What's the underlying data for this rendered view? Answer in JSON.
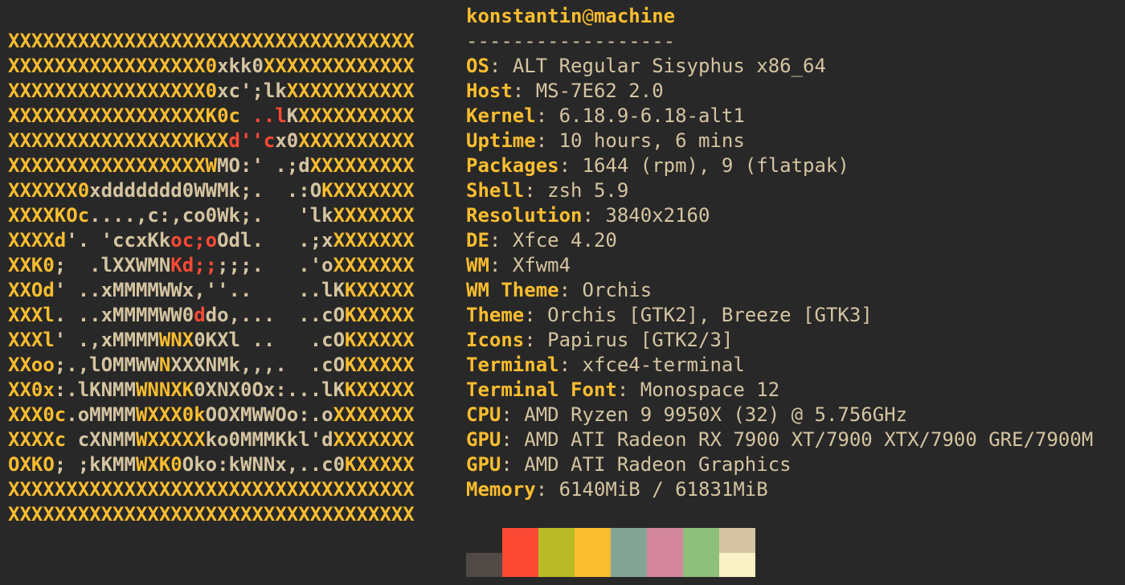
{
  "colors": {
    "background": "#282828",
    "foreground": "#d5c4a1",
    "accent_yellow": "#fabd2f",
    "accent_red": "#fb4934"
  },
  "logo": {
    "lines": [
      [
        {
          "t": "XXXXXXXXXXXXXXXXXXXXXXXXXXXXXXXXXXX",
          "c": "y"
        }
      ],
      [
        {
          "t": "XXXXXXXXXXXXXXXXX0",
          "c": "y"
        },
        {
          "t": "xkk0",
          "c": "w"
        },
        {
          "t": "XXXXXXXXXXXXX",
          "c": "y"
        }
      ],
      [
        {
          "t": "XXXXXXXXXXXXXXXXX0",
          "c": "y"
        },
        {
          "t": "xc';lk",
          "c": "w"
        },
        {
          "t": "XXXXXXXXXXX",
          "c": "y"
        }
      ],
      [
        {
          "t": "XXXXXXXXXXXXXXXXXK0c ",
          "c": "y"
        },
        {
          "t": "..l",
          "c": "r"
        },
        {
          "t": "K",
          "c": "w"
        },
        {
          "t": "XXXXXXXXXX",
          "c": "y"
        }
      ],
      [
        {
          "t": "XXXXXXXXXXXXXXXXKXX",
          "c": "y"
        },
        {
          "t": "d''c",
          "c": "r"
        },
        {
          "t": "x0",
          "c": "w"
        },
        {
          "t": "XXXXXXXXXX",
          "c": "y"
        }
      ],
      [
        {
          "t": "XXXXXXXXXXXXXXXXXW",
          "c": "y"
        },
        {
          "t": "MO:' .;d",
          "c": "w"
        },
        {
          "t": "XXXXXXXXX",
          "c": "y"
        }
      ],
      [
        {
          "t": "XXXXXX0",
          "c": "y"
        },
        {
          "t": "xddddddd0WWMk;.  .:O",
          "c": "w"
        },
        {
          "t": "KXXXXXXX",
          "c": "y"
        }
      ],
      [
        {
          "t": "XXXXKOc",
          "c": "y"
        },
        {
          "t": "....,c:,co0Wk;.   'lk",
          "c": "w"
        },
        {
          "t": "XXXXXXX",
          "c": "y"
        }
      ],
      [
        {
          "t": "XXXXd",
          "c": "y"
        },
        {
          "t": "'. 'ccxKk",
          "c": "w"
        },
        {
          "t": "oc;o",
          "c": "r"
        },
        {
          "t": "Odl.   .;x",
          "c": "w"
        },
        {
          "t": "XXXXXXX",
          "c": "y"
        }
      ],
      [
        {
          "t": "XXK0",
          "c": "y"
        },
        {
          "t": ";  .lXXWMN",
          "c": "w"
        },
        {
          "t": "Kd;;",
          "c": "r"
        },
        {
          "t": ";;;.   .'o",
          "c": "w"
        },
        {
          "t": "XXXXXXX",
          "c": "y"
        }
      ],
      [
        {
          "t": "XXOd",
          "c": "y"
        },
        {
          "t": "' ..xMMMMWWx,''..    ..lK",
          "c": "w"
        },
        {
          "t": "KXXXXX",
          "c": "y"
        }
      ],
      [
        {
          "t": "XXXl",
          "c": "y"
        },
        {
          "t": ". ..xMMMMWW0",
          "c": "w"
        },
        {
          "t": "d",
          "c": "r"
        },
        {
          "t": "do,...  ..cO",
          "c": "w"
        },
        {
          "t": "KXXXXX",
          "c": "y"
        }
      ],
      [
        {
          "t": "XXXl",
          "c": "y"
        },
        {
          "t": "' .,xMMMM",
          "c": "w"
        },
        {
          "t": "WNX",
          "c": "y"
        },
        {
          "t": "0KXl ..   .cO",
          "c": "w"
        },
        {
          "t": "KXXXXX",
          "c": "y"
        }
      ],
      [
        {
          "t": "XXoo",
          "c": "y"
        },
        {
          "t": ";.,lOMMWW",
          "c": "w"
        },
        {
          "t": "N",
          "c": "y"
        },
        {
          "t": "XXXNMk,,,.  .cO",
          "c": "w"
        },
        {
          "t": "KXXXXX",
          "c": "y"
        }
      ],
      [
        {
          "t": "XX0x",
          "c": "y"
        },
        {
          "t": ":.lKNMM",
          "c": "w"
        },
        {
          "t": "WNNXK",
          "c": "y"
        },
        {
          "t": "0XNX0Ox:...lK",
          "c": "w"
        },
        {
          "t": "KXXXXX",
          "c": "y"
        }
      ],
      [
        {
          "t": "XXX0c",
          "c": "y"
        },
        {
          "t": ".oMMMM",
          "c": "w"
        },
        {
          "t": "WXXX0k",
          "c": "y"
        },
        {
          "t": "OOXMWWOo:.o",
          "c": "w"
        },
        {
          "t": "XXXXXXX",
          "c": "y"
        }
      ],
      [
        {
          "t": "XXXXc",
          "c": "y"
        },
        {
          "t": " cXNMM",
          "c": "w"
        },
        {
          "t": "WXXXXX",
          "c": "y"
        },
        {
          "t": "ko0MMMKkl'd",
          "c": "w"
        },
        {
          "t": "XXXXXXX",
          "c": "y"
        }
      ],
      [
        {
          "t": "OXKO",
          "c": "y"
        },
        {
          "t": "; ;kKMM",
          "c": "w"
        },
        {
          "t": "WXK0",
          "c": "y"
        },
        {
          "t": "Oko:kWNNx,..c0",
          "c": "w"
        },
        {
          "t": "KXXXXX",
          "c": "y"
        }
      ],
      [
        {
          "t": "XXXXXXXXXXXXXXXXXXXXXXXXXXXXXXXXXXX",
          "c": "y"
        }
      ],
      [
        {
          "t": "XXXXXXXXXXXXXXXXXXXXXXXXXXXXXXXXXXX",
          "c": "y"
        }
      ]
    ]
  },
  "title": {
    "user": "konstantin",
    "separator": "@",
    "host": "machine",
    "underline": "------------------"
  },
  "info": [
    {
      "key": "OS",
      "value": "ALT Regular Sisyphus x86_64"
    },
    {
      "key": "Host",
      "value": "MS-7E62 2.0"
    },
    {
      "key": "Kernel",
      "value": "6.18.9-6.18-alt1"
    },
    {
      "key": "Uptime",
      "value": "10 hours, 6 mins"
    },
    {
      "key": "Packages",
      "value": "1644 (rpm), 9 (flatpak)"
    },
    {
      "key": "Shell",
      "value": "zsh 5.9"
    },
    {
      "key": "Resolution",
      "value": "3840x2160"
    },
    {
      "key": "DE",
      "value": "Xfce 4.20"
    },
    {
      "key": "WM",
      "value": "Xfwm4"
    },
    {
      "key": "WM Theme",
      "value": "Orchis"
    },
    {
      "key": "Theme",
      "value": "Orchis [GTK2], Breeze [GTK3]"
    },
    {
      "key": "Icons",
      "value": "Papirus [GTK2/3]"
    },
    {
      "key": "Terminal",
      "value": "xfce4-terminal"
    },
    {
      "key": "Terminal Font",
      "value": "Monospace 12"
    },
    {
      "key": "CPU",
      "value": "AMD Ryzen 9 9950X (32) @ 5.756GHz"
    },
    {
      "key": "GPU",
      "value": "AMD ATI Radeon RX 7900 XT/7900 XTX/7900 GRE/7900M"
    },
    {
      "key": "GPU",
      "value": "AMD ATI Radeon Graphics"
    },
    {
      "key": "Memory",
      "value": "6140MiB / 61831MiB"
    }
  ],
  "palette": {
    "normal": [
      "#282828",
      "#fb4934",
      "#b8bb26",
      "#fabd2f",
      "#83a598",
      "#d3869b",
      "#8ec07c",
      "#d5c4a1"
    ],
    "bright": [
      "#504945",
      "#fb4934",
      "#b8bb26",
      "#fabd2f",
      "#83a598",
      "#d3869b",
      "#8ec07c",
      "#fbf1c7"
    ]
  }
}
